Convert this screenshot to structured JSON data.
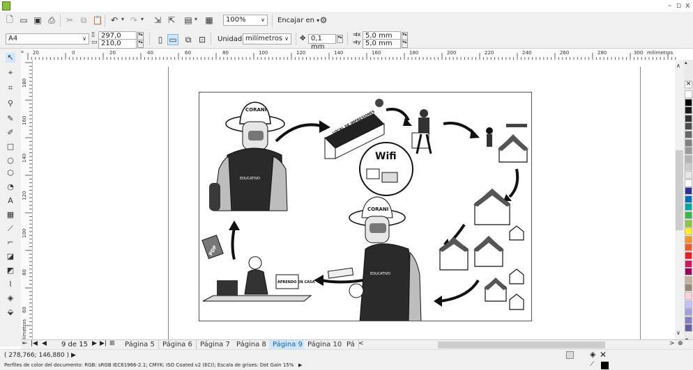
{
  "toolbar": {
    "zoom_value": "100%",
    "snap_label": "Encajar en",
    "snap_arrow": "▾"
  },
  "propbar": {
    "paper_size": "A4",
    "width": "297,0 mm",
    "height": "210,0 mm",
    "units_label": "Unidades:",
    "units_value": "milímetros",
    "nudge": "0,1 mm",
    "dup_x": "5,0 mm",
    "dup_y": "5,0 mm"
  },
  "rulers": {
    "h_ticks": [
      "20",
      "0",
      "20",
      "40",
      "60",
      "80",
      "100",
      "120",
      "140",
      "160",
      "180",
      "200",
      "220",
      "240",
      "260",
      "280",
      "300"
    ],
    "h_unit": "milímetros",
    "v_ticks": [
      "180",
      "160",
      "140",
      "120",
      "100",
      "80",
      "60"
    ],
    "v_unit": "milímetros"
  },
  "illustration": {
    "cap_text": "CORANI",
    "vest_text": "EDUCATIVO",
    "shop_sign": "LOCAL DE IMPRESIONES",
    "wifi_text": "Wifi",
    "pdf_text": "PDF",
    "book_text": "APRENDO EN CASA"
  },
  "pagebar": {
    "counter": "9 de 15",
    "tabs": [
      "Página 5",
      "Página 6",
      "Página 7",
      "Página 8",
      "Página 9",
      "Página 10",
      "Pá"
    ],
    "active_tab": "Página 9"
  },
  "status": {
    "coords": "( 278,766; 146,880 )",
    "coords_arrow": "▶",
    "color_profile": "Perfiles de color del documento: RGB: sRGB IEC61966-2.1; CMYK: ISO Coated v2 (ECI); Escala de grises: Dot Gain 15%",
    "profile_arrow": "▶"
  },
  "palette_colors": [
    "#ffffff",
    "#000000",
    "#1a1a1a",
    "#333333",
    "#4d4d4d",
    "#666666",
    "#808080",
    "#999999",
    "#b3b3b3",
    "#cccccc",
    "#e6e6e6",
    "#ffffff",
    "#2e3192",
    "#0071bc",
    "#00a99d",
    "#39b54a",
    "#8cc63f",
    "#fcee21",
    "#f7931e",
    "#f15a24",
    "#ed1c24",
    "#d4145a",
    "#9e005d",
    "#c7b299",
    "#998675",
    "#ffd1dc",
    "#c1c1ff",
    "#a0a0e0",
    "#8080c0",
    "#6060a0"
  ]
}
